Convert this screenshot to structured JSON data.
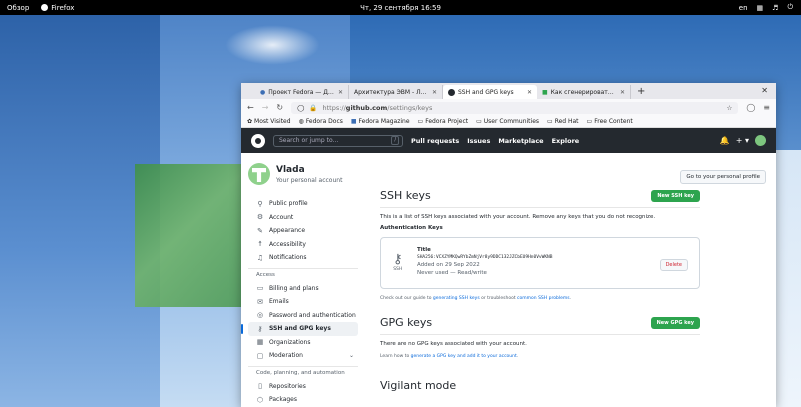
{
  "topbar": {
    "overview": "Обзор",
    "app": "Firefox",
    "clock": "Чт, 29 сентября 16:59",
    "lang": "en"
  },
  "browser": {
    "tabs": [
      {
        "label": "Проект Fedora — Домаш",
        "icon": "fedora-icon",
        "active": false
      },
      {
        "label": "Архитектура ЭВМ - Лабора",
        "icon": "doc-icon",
        "active": false
      },
      {
        "label": "SSH and GPG keys",
        "icon": "github-icon",
        "active": true
      },
      {
        "label": "Как сгенерировать SSH-",
        "icon": "site-icon",
        "active": false
      }
    ],
    "url_prefix": "https://",
    "url_host": "github.com",
    "url_path": "/settings/keys",
    "bookmarks": [
      "Most Visited",
      "Fedora Docs",
      "Fedora Magazine",
      "Fedora Project",
      "User Communities",
      "Red Hat",
      "Free Content"
    ]
  },
  "github": {
    "search_placeholder": "Search or jump to...",
    "search_key": "/",
    "nav": [
      "Pull requests",
      "Issues",
      "Marketplace",
      "Explore"
    ]
  },
  "user": {
    "name": "Vlada",
    "subtitle": "Your personal account",
    "go_profile": "Go to your personal profile"
  },
  "sidebar": {
    "items_top": [
      {
        "label": "Public profile",
        "icon": "person-icon"
      },
      {
        "label": "Account",
        "icon": "gear-icon"
      },
      {
        "label": "Appearance",
        "icon": "paintbrush-icon"
      },
      {
        "label": "Accessibility",
        "icon": "accessibility-icon"
      },
      {
        "label": "Notifications",
        "icon": "bell-icon"
      }
    ],
    "access_heading": "Access",
    "items_access": [
      {
        "label": "Billing and plans",
        "icon": "credit-card-icon"
      },
      {
        "label": "Emails",
        "icon": "mail-icon"
      },
      {
        "label": "Password and authentication",
        "icon": "shield-icon"
      },
      {
        "label": "SSH and GPG keys",
        "icon": "key-icon",
        "active": true
      },
      {
        "label": "Organizations",
        "icon": "organization-icon"
      },
      {
        "label": "Moderation",
        "icon": "report-icon"
      }
    ],
    "code_heading": "Code, planning, and automation",
    "items_code": [
      {
        "label": "Repositories",
        "icon": "repo-icon"
      },
      {
        "label": "Packages",
        "icon": "package-icon"
      }
    ]
  },
  "ssh": {
    "title": "SSH keys",
    "new_button": "New SSH key",
    "description": "This is a list of SSH keys associated with your account. Remove any keys that you do not recognize.",
    "auth_heading": "Authentication Keys",
    "key": {
      "type_label": "SSH",
      "title": "Title",
      "fingerprint": "SHA256:VCXZYMKQwRYbZmNjVr8y9DDC132JZCbEU9Hn0VvWKNB",
      "added": "Added on 29 Sep 2022",
      "usage": "Never used — Read/write",
      "delete": "Delete"
    },
    "guide_pre": "Check out our guide to ",
    "guide_link1": "generating SSH keys",
    "guide_mid": " or troubleshoot ",
    "guide_link2": "common SSH problems",
    "guide_post": "."
  },
  "gpg": {
    "title": "GPG keys",
    "new_button": "New GPG key",
    "empty": "There are no GPG keys associated with your account.",
    "learn_pre": "Learn how to ",
    "learn_link": "generate a GPG key and add it to your account",
    "learn_post": "."
  },
  "vigilant": {
    "title": "Vigilant mode"
  }
}
